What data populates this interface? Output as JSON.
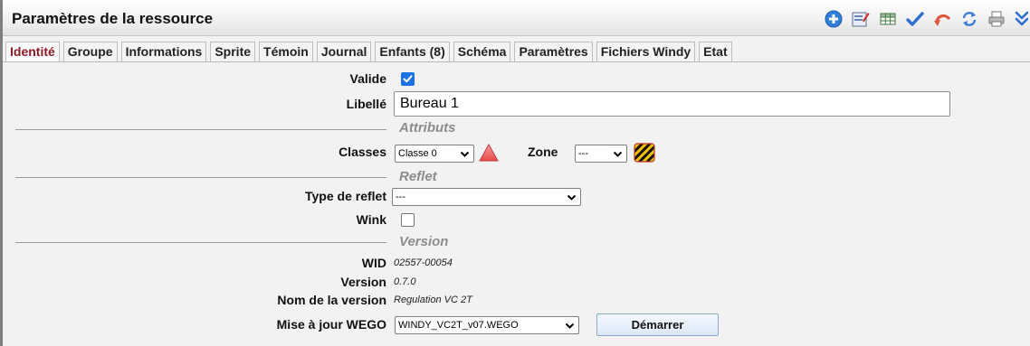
{
  "panel": {
    "title": "Paramètres de la ressource"
  },
  "toolbar": [
    {
      "name": "add-icon"
    },
    {
      "name": "edit-form-icon"
    },
    {
      "name": "grid-icon"
    },
    {
      "name": "checkmark-icon"
    },
    {
      "name": "undo-icon"
    },
    {
      "name": "refresh-icon"
    },
    {
      "name": "print-icon"
    },
    {
      "name": "double-chevron-down-icon"
    }
  ],
  "tabs": [
    {
      "label": "Identité",
      "active": true
    },
    {
      "label": "Groupe"
    },
    {
      "label": "Informations"
    },
    {
      "label": "Sprite"
    },
    {
      "label": "Témoin"
    },
    {
      "label": "Journal"
    },
    {
      "label": "Enfants (8)"
    },
    {
      "label": "Schéma"
    },
    {
      "label": "Paramètres"
    },
    {
      "label": "Fichiers Windy"
    },
    {
      "label": "Etat"
    }
  ],
  "form": {
    "valide": {
      "label": "Valide",
      "checked": true
    },
    "libelle": {
      "label": "Libellé",
      "value": "Bureau 1"
    },
    "attributs": {
      "title": "Attributs"
    },
    "classes": {
      "label": "Classes",
      "value": "Classe 0"
    },
    "zone": {
      "label": "Zone",
      "value": "---"
    },
    "reflet": {
      "title": "Reflet"
    },
    "type_reflet": {
      "label": "Type de reflet",
      "value": "---"
    },
    "wink": {
      "label": "Wink",
      "checked": false
    },
    "version_section": {
      "title": "Version"
    },
    "wid": {
      "label": "WID",
      "value": "02557-00054"
    },
    "version": {
      "label": "Version",
      "value": "0.7.0"
    },
    "nom_version": {
      "label": "Nom de la version",
      "value": "Regulation VC 2T"
    },
    "mise_a_jour": {
      "label": "Mise à jour WEGO",
      "value": "WINDY_VC2T_v07.WEGO"
    },
    "demarrer": {
      "label": "Démarrer"
    }
  },
  "colors": {
    "accent": "#1a73e8",
    "active_tab": "#8a1b24",
    "section_title": "#8c8c8c"
  }
}
